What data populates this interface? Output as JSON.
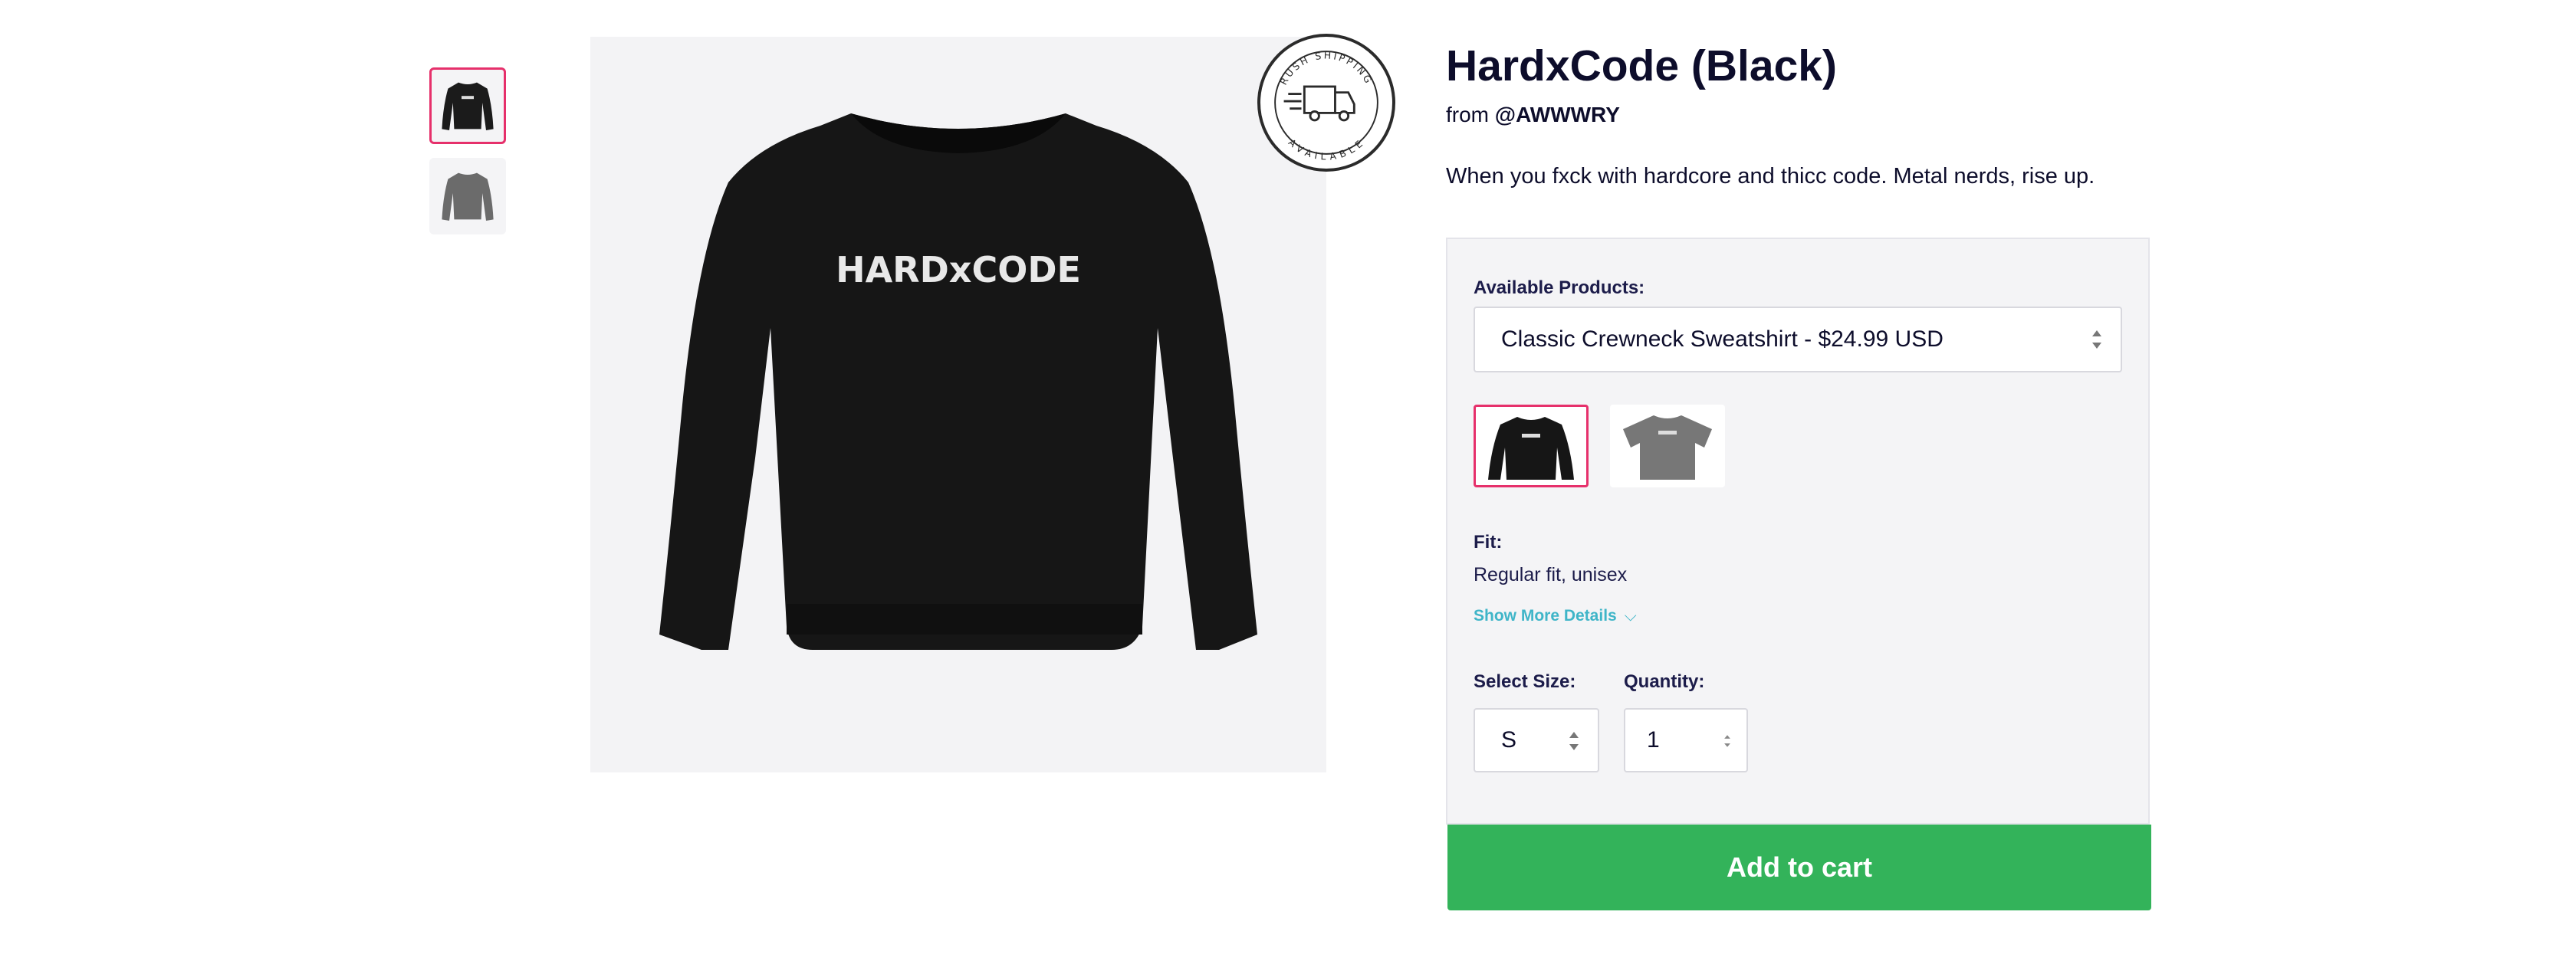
{
  "product": {
    "title": "HardxCode (Black)",
    "by_prefix": "from ",
    "by_handle": "@AWWWRY",
    "description": "When you fxck with hardcore and thicc code. Metal nerds, rise up.",
    "print_text": "HARDxCODE"
  },
  "badge": {
    "top_text": "RUSH SHIPPING",
    "bottom_text": "AVAILABLE"
  },
  "thumbnails": [
    {
      "color": "black",
      "active": true
    },
    {
      "color": "gray",
      "active": false
    }
  ],
  "options": {
    "available_label": "Available Products:",
    "selected_product": "Classic Crewneck Sweatshirt - $24.99 USD",
    "swatches": [
      {
        "style": "sweatshirt-black",
        "active": true
      },
      {
        "style": "tshirt-gray",
        "active": false
      }
    ],
    "fit_label": "Fit:",
    "fit_value": "Regular fit, unisex",
    "show_more": "Show More Details",
    "size_label": "Select Size:",
    "size_value": "S",
    "quantity_label": "Quantity:",
    "quantity_value": "1"
  },
  "cart": {
    "label": "Add to cart",
    "color": "#33b35a"
  },
  "colors": {
    "accent": "#e6306b",
    "link": "#3fb5c8",
    "text": "#0d0d2b",
    "panel": "#f4f4f6"
  }
}
